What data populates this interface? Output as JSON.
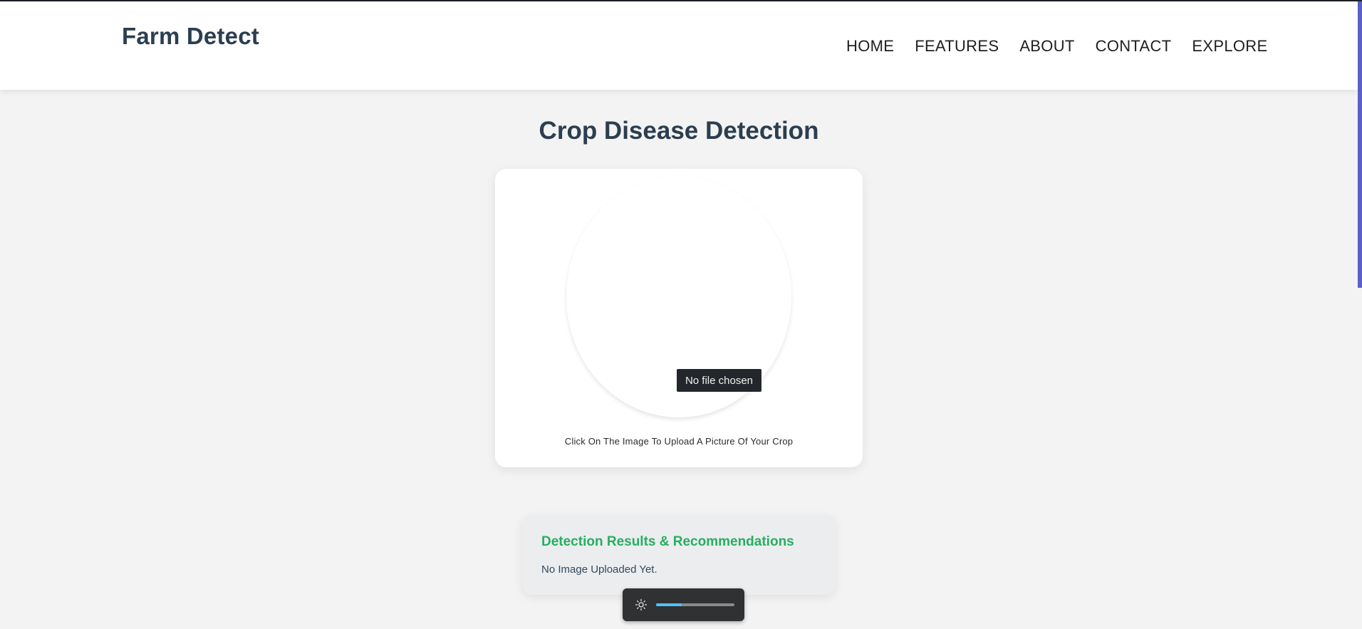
{
  "navbar": {
    "brand": "Farm Detect",
    "links": [
      "HOME",
      "FEATURES",
      "ABOUT",
      "CONTACT",
      "EXPLORE"
    ]
  },
  "main": {
    "title": "Crop Disease Detection",
    "upload": {
      "tooltip": "No file chosen",
      "hint": "Click On The Image To Upload A Picture Of Your Crop"
    },
    "results": {
      "title": "Detection Results & Recommendations",
      "text": "No Image Uploaded Yet."
    }
  },
  "brightness": {
    "icon": "sun-icon",
    "level_fraction": 0.33
  },
  "colors": {
    "accent_green": "#27ae60",
    "heading": "#2c3e50",
    "scrollbar": "#5b5fc7",
    "slider_fill": "#4fc3f7"
  }
}
